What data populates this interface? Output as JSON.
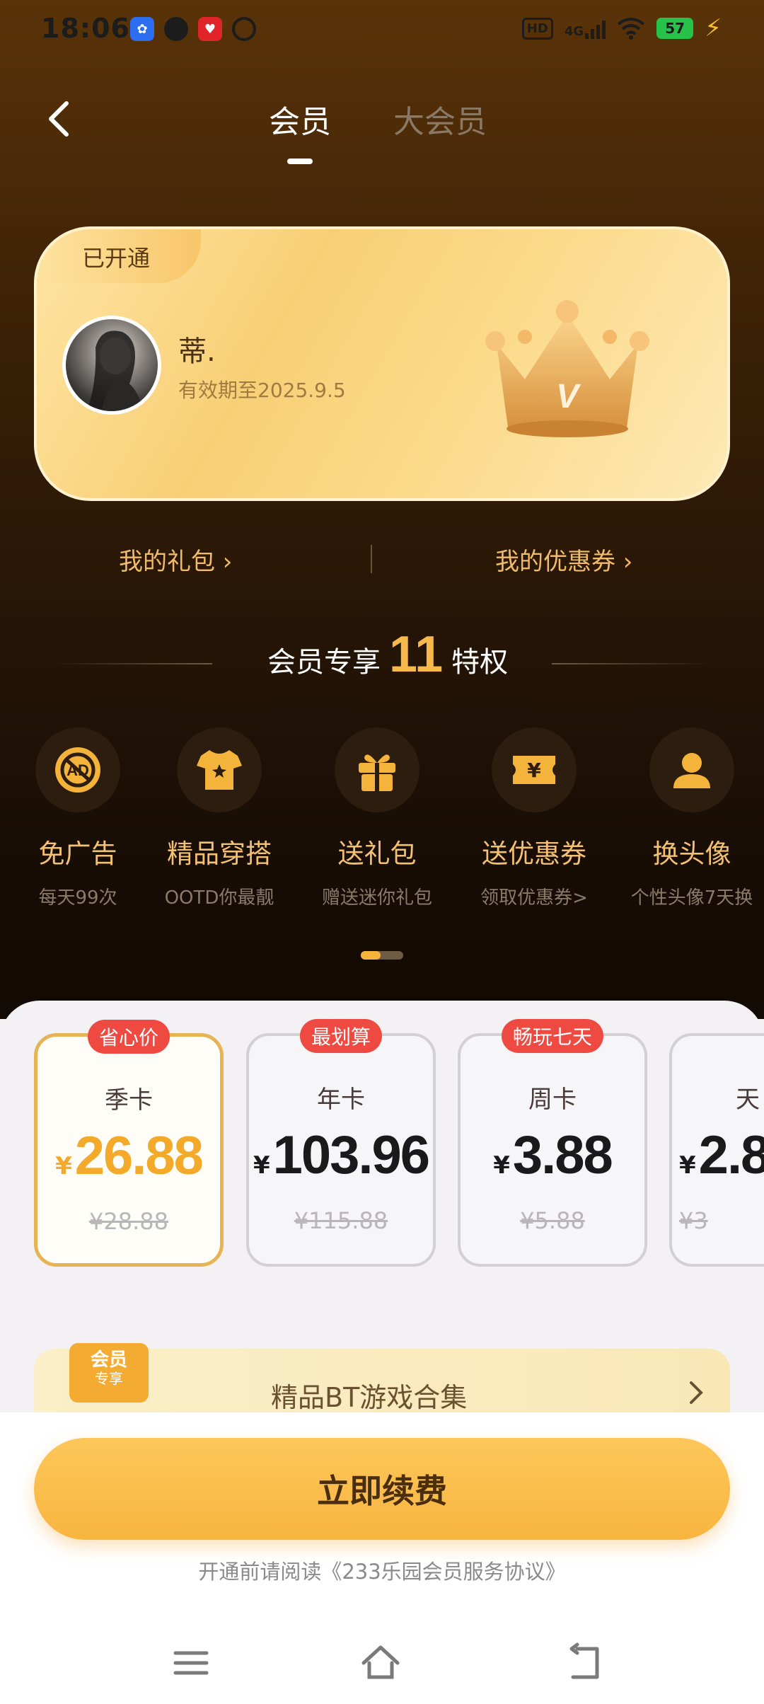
{
  "status_bar": {
    "time": "18:06",
    "hd_label": "HD",
    "network": "4G",
    "battery": "57"
  },
  "header": {
    "tabs": [
      {
        "label": "会员",
        "active": true
      },
      {
        "label": "大会员",
        "active": false
      }
    ]
  },
  "member_card": {
    "tag": "已开通",
    "username": "蒂.",
    "expiry": "有效期至2025.9.5",
    "crown_letter": "V"
  },
  "links": {
    "gift": "我的礼包 ›",
    "coupons": "我的优惠券 ›"
  },
  "privileges": {
    "title_prefix": "会员专享",
    "count": "11",
    "title_suffix": "特权",
    "items": [
      {
        "name": "免广告",
        "desc": "每天99次",
        "icon": "no-ads-icon"
      },
      {
        "name": "精品穿搭",
        "desc": "OOTD你最靓",
        "icon": "tshirt-icon"
      },
      {
        "name": "送礼包",
        "desc": "赠送迷你礼包",
        "icon": "gift-icon"
      },
      {
        "name": "送优惠券",
        "desc": "领取优惠券>",
        "icon": "coupon-icon"
      },
      {
        "name": "换头像",
        "desc": "个性头像7天换",
        "icon": "user-icon"
      }
    ]
  },
  "plans": [
    {
      "badge": "省心价",
      "name": "季卡",
      "currency": "¥",
      "price": "26.88",
      "original": "¥28.88",
      "selected": true
    },
    {
      "badge": "最划算",
      "name": "年卡",
      "currency": "¥",
      "price": "103.96",
      "original": "¥115.88",
      "selected": false
    },
    {
      "badge": "畅玩七天",
      "name": "周卡",
      "currency": "¥",
      "price": "3.88",
      "original": "¥5.88",
      "selected": false
    },
    {
      "badge": "",
      "name": "天",
      "currency": "¥",
      "price": "2.8",
      "original": "¥3",
      "selected": false
    }
  ],
  "promo": {
    "badge_top": "会员",
    "badge_bottom": "专享",
    "text": "精品BT游戏合集"
  },
  "cta": {
    "label": "立即续费"
  },
  "agreement": "开通前请阅读《233乐园会员服务协议》",
  "colors": {
    "accent": "#f8b53f",
    "gold_text": "#f3c173",
    "badge_red": "#ee4a42"
  }
}
